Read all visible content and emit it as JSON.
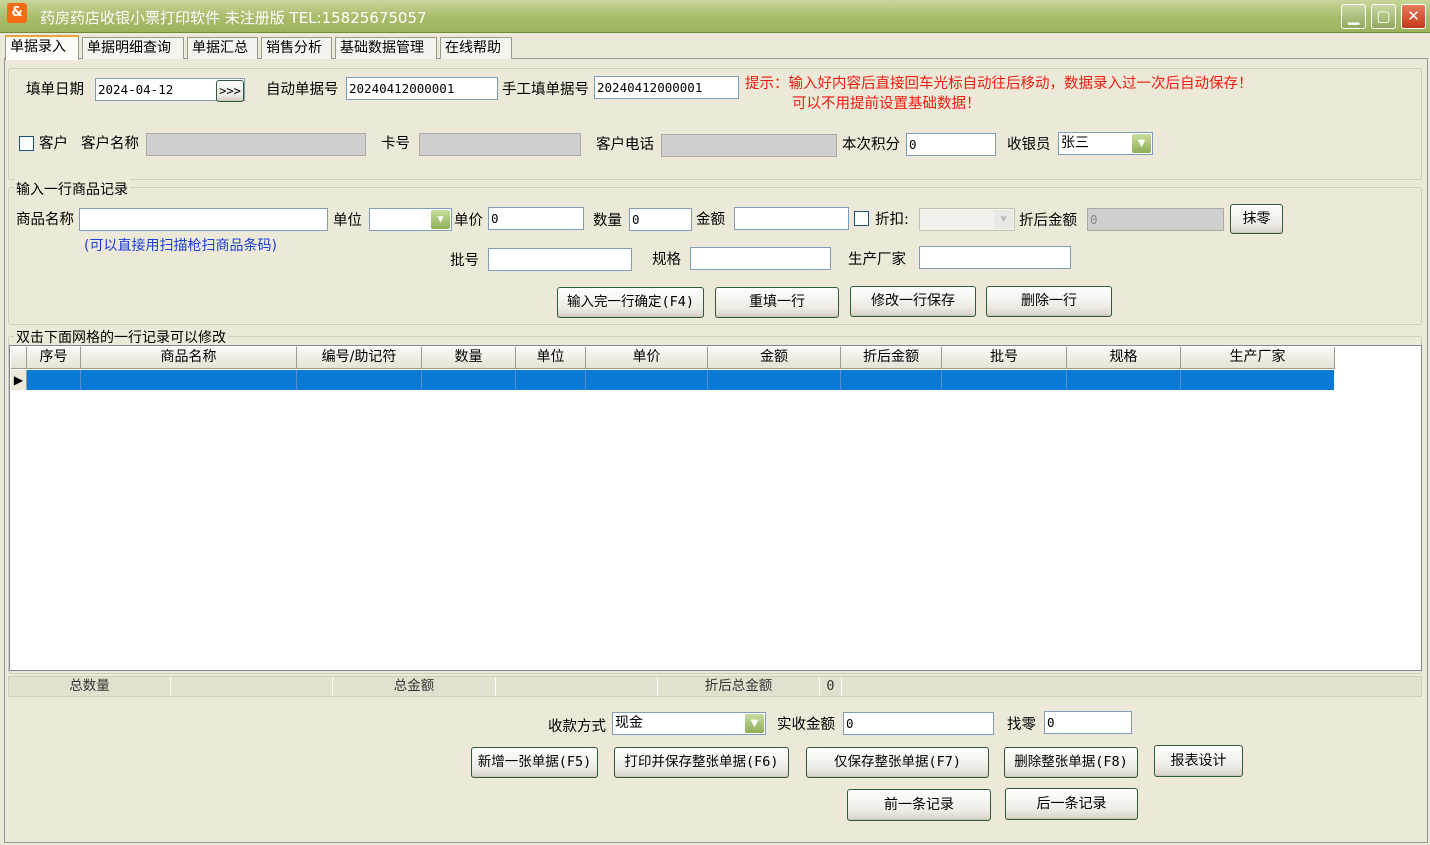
{
  "window": {
    "title": "药房药店收银小票打印软件 未注册版 TEL:15825675057",
    "app_icon_glyph": "&",
    "minimize_glyph": "▁",
    "maximize_glyph": "▢",
    "close_glyph": "✕"
  },
  "tabs": [
    {
      "label": "单据录入",
      "active": true
    },
    {
      "label": "单据明细查询"
    },
    {
      "label": "单据汇总"
    },
    {
      "label": "销售分析"
    },
    {
      "label": "基础数据管理"
    },
    {
      "label": "在线帮助"
    }
  ],
  "header": {
    "date_label": "填单日期",
    "date_value": "2024-04-12",
    "date_button": ">>>",
    "auto_no_label": "自动单据号",
    "auto_no_value": "20240412000001",
    "manual_no_label": "手工填单据号",
    "manual_no_value": "20240412000001",
    "hint_line1": "提示：输入好内容后直接回车光标自动往后移动，数据录入过一次后自动保存！",
    "hint_line2": "可以不用提前设置基础数据！",
    "customer_check_label": "客户",
    "customer_name_label": "客户名称",
    "card_label": "卡号",
    "phone_label": "客户电话",
    "points_label": "本次积分",
    "points_value": "0",
    "cashier_label": "收银员",
    "cashier_value": "张三"
  },
  "item_entry": {
    "group_title": "输入一行商品记录",
    "product_label": "商品名称",
    "scan_hint": "(可以直接用扫描枪扫商品条码)",
    "unit_label": "单位",
    "price_label": "单价",
    "price_value": "0",
    "qty_label": "数量",
    "qty_value": "0",
    "amount_label": "金额",
    "discount_label": "折扣:",
    "discounted_label": "折后金额",
    "discounted_value": "0",
    "round_button": "抹零",
    "batch_label": "批号",
    "spec_label": "规格",
    "maker_label": "生产厂家",
    "btn_confirm": "输入完一行确定(F4)",
    "btn_refill": "重填一行",
    "btn_modify": "修改一行保存",
    "btn_delete": "删除一行"
  },
  "grid": {
    "group_title": "双击下面网格的一行记录可以修改",
    "columns": [
      "序号",
      "商品名称",
      "编号/助记符",
      "数量",
      "单位",
      "单价",
      "金额",
      "折后金额",
      "批号",
      "规格",
      "生产厂家"
    ],
    "row_indicator": "▶"
  },
  "summary": {
    "total_qty_label": "总数量",
    "total_amount_label": "总金额",
    "discount_total_label": "折后总金额",
    "discount_total_value": "0"
  },
  "payment": {
    "method_label": "收款方式",
    "method_value": "现金",
    "received_label": "实收金额",
    "received_value": "0",
    "change_label": "找零",
    "change_value": "0"
  },
  "actions": {
    "new_bill": "新增一张单据(F5)",
    "print_save": "打印并保存整张单据(F6)",
    "save_only": "仅保存整张单据(F7)",
    "delete_bill": "删除整张单据(F8)",
    "report_design": "报表设计",
    "prev": "前一条记录",
    "next": "后一条记录"
  }
}
